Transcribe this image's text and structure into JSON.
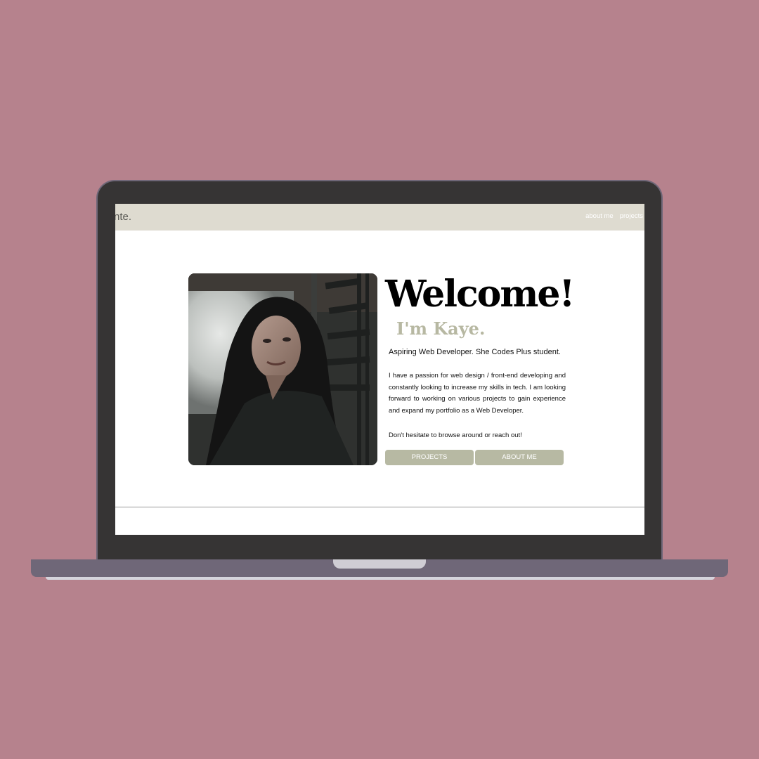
{
  "navbar": {
    "brand": "nte.",
    "links": [
      "about me",
      "projects"
    ]
  },
  "hero": {
    "photo_icon": "portrait-photo",
    "welcome": "Welcome!",
    "intro": "I'm Kaye.",
    "tagline": "Aspiring Web Developer. She Codes Plus student.",
    "bio": "I have a passion for web design / front-end developing and constantly looking to increase my skills in tech. I am looking forward to working on various projects to gain experience and expand my portfolio as a Web Developer.",
    "cta": "Don't hesitate to browse around or reach out!",
    "buttons": {
      "projects": "PROJECTS",
      "about": "ABOUT ME"
    }
  },
  "colors": {
    "background": "#b6828d",
    "laptop_bezel": "#363434",
    "laptop_base": "#6f6778",
    "navbar": "#dedbd0",
    "accent": "#b7b9a3"
  }
}
